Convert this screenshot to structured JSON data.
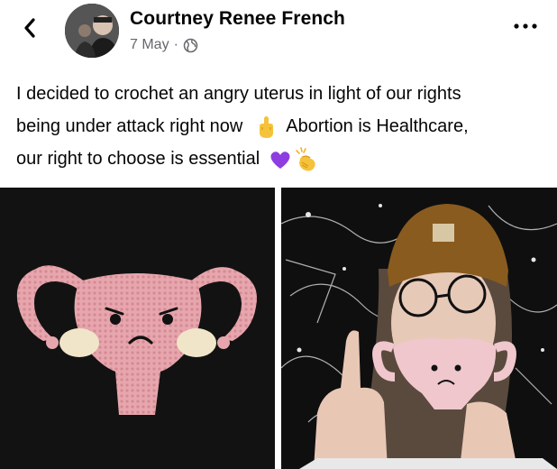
{
  "post": {
    "author_name": "Courtney Renee French",
    "date": "7 May",
    "separator": "·",
    "caption": {
      "line1": "I decided to crochet an angry uterus in light of our rights",
      "line2_a": "being under attack right now",
      "line2_b": "Abortion is Healthcare,",
      "line3": "our right to choose is essential"
    }
  },
  "icons": {
    "back": "chevron-left-icon",
    "privacy": "globe-icon",
    "more": "more-options-icon",
    "emoji_1": "middle-finger-emoji",
    "emoji_2": "purple-heart-emoji",
    "emoji_3": "clapping-hands-emoji"
  },
  "colors": {
    "text_primary": "#050505",
    "text_secondary": "#65676b",
    "crochet_pink": "#e8a7ae"
  }
}
